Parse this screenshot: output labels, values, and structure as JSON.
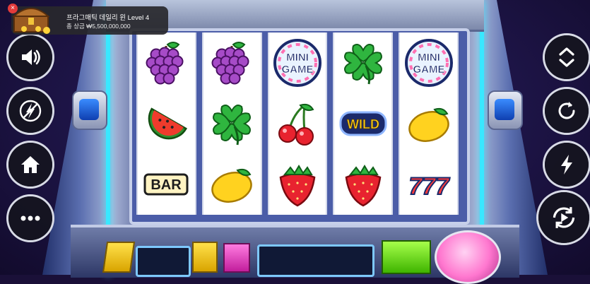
{
  "notification": {
    "title": "프라그매틱 데일리 윈 Level 4",
    "subtitle": "총 상금 ₩5,500,000,000",
    "close_glyph": "×",
    "icon": "treasure-chest-icon"
  },
  "left_controls": [
    {
      "name": "sound-button",
      "icon": "speaker-icon"
    },
    {
      "name": "turbo-button",
      "icon": "lightning-off-icon"
    },
    {
      "name": "home-button",
      "icon": "home-icon"
    },
    {
      "name": "menu-button",
      "icon": "more-dots-icon"
    }
  ],
  "right_controls": [
    {
      "name": "bet-adjust-button",
      "icon": "chevron-up-down-icon"
    },
    {
      "name": "spin-button",
      "icon": "refresh-icon"
    },
    {
      "name": "quick-spin-button",
      "icon": "lightning-icon"
    },
    {
      "name": "autoplay-button",
      "icon": "autoplay-icon"
    }
  ],
  "reels": [
    [
      "grapes",
      "watermelon",
      "bar"
    ],
    [
      "grapes",
      "clover",
      "lemon"
    ],
    [
      "mini-game",
      "cherries",
      "strawberry"
    ],
    [
      "clover",
      "wild",
      "strawberry"
    ],
    [
      "mini-game",
      "lemon",
      "seven"
    ]
  ],
  "symbol_labels": {
    "bar": "BAR",
    "wild": "WILD",
    "mini_top": "MINI",
    "mini_bottom": "GAME",
    "seven": "777"
  },
  "colors": {
    "accent_neon": "#39e8ff",
    "neon_pink": "#ff3fb4",
    "panel_yellow": "#ffe14a",
    "panel_pink": "#ff7be0",
    "panel_green": "#a6ff4a"
  }
}
